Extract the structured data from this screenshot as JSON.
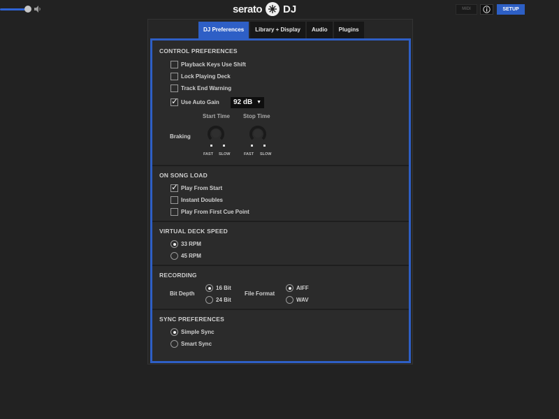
{
  "logo": {
    "word": "serato",
    "suffix": "DJ"
  },
  "topbar": {
    "midi_label": "MIDI",
    "info_label": "i",
    "setup_label": "SETUP"
  },
  "tabs": [
    {
      "label": "DJ Preferences",
      "active": true
    },
    {
      "label": "Library + Display",
      "active": false
    },
    {
      "label": "Audio",
      "active": false
    },
    {
      "label": "Plugins",
      "active": false
    }
  ],
  "control_preferences": {
    "title": "CONTROL PREFERENCES",
    "items": [
      {
        "label": "Playback Keys Use Shift",
        "checked": false
      },
      {
        "label": "Lock Playing Deck",
        "checked": false
      },
      {
        "label": "Track End Warning",
        "checked": false
      },
      {
        "label": "Use Auto Gain",
        "checked": true
      }
    ],
    "auto_gain_value": "92 dB",
    "braking": {
      "label": "Braking",
      "start_label": "Start Time",
      "stop_label": "Stop Time",
      "fast_label": "FAST",
      "slow_label": "SLOW"
    }
  },
  "on_song_load": {
    "title": "ON SONG LOAD",
    "items": [
      {
        "label": "Play From Start",
        "checked": true
      },
      {
        "label": "Instant Doubles",
        "checked": false
      },
      {
        "label": "Play From First Cue Point",
        "checked": false
      }
    ]
  },
  "virtual_deck_speed": {
    "title": "VIRTUAL DECK SPEED",
    "options": [
      {
        "label": "33 RPM",
        "selected": true
      },
      {
        "label": "45 RPM",
        "selected": false
      }
    ]
  },
  "recording": {
    "title": "RECORDING",
    "bit_depth_label": "Bit Depth",
    "bit_depth_options": [
      {
        "label": "16 Bit",
        "selected": true
      },
      {
        "label": "24 Bit",
        "selected": false
      }
    ],
    "file_format_label": "File Format",
    "file_format_options": [
      {
        "label": "AIFF",
        "selected": true
      },
      {
        "label": "WAV",
        "selected": false
      }
    ]
  },
  "sync_preferences": {
    "title": "SYNC PREFERENCES",
    "options": [
      {
        "label": "Simple Sync",
        "selected": true
      },
      {
        "label": "Smart Sync",
        "selected": false
      }
    ]
  },
  "colors": {
    "accent": "#2e5fc6",
    "background": "#222222",
    "panel": "#2b2b2b"
  }
}
